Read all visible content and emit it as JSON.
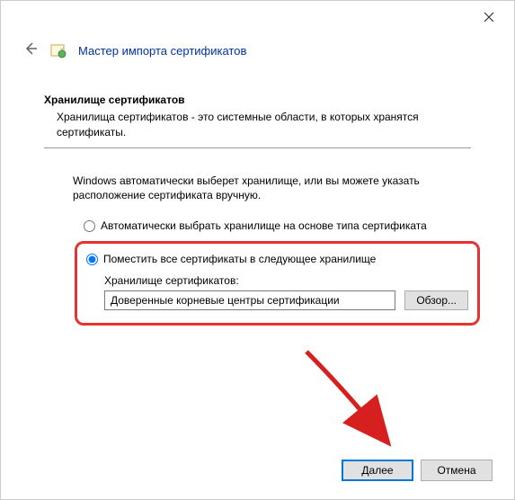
{
  "wizard": {
    "title": "Мастер импорта сертификатов"
  },
  "section": {
    "heading": "Хранилище сертификатов",
    "description": "Хранилища сертификатов - это системные области, в которых хранятся сертификаты."
  },
  "instruction": "Windows автоматически выберет хранилище, или вы можете указать расположение сертификата вручную.",
  "options": {
    "auto": "Автоматически выбрать хранилище на основе типа сертификата",
    "manual": "Поместить все сертификаты в следующее хранилище"
  },
  "store": {
    "label": "Хранилище сертификатов:",
    "value": "Доверенные корневые центры сертификации",
    "browse": "Обзор..."
  },
  "buttons": {
    "next": "Далее",
    "cancel": "Отмена"
  }
}
